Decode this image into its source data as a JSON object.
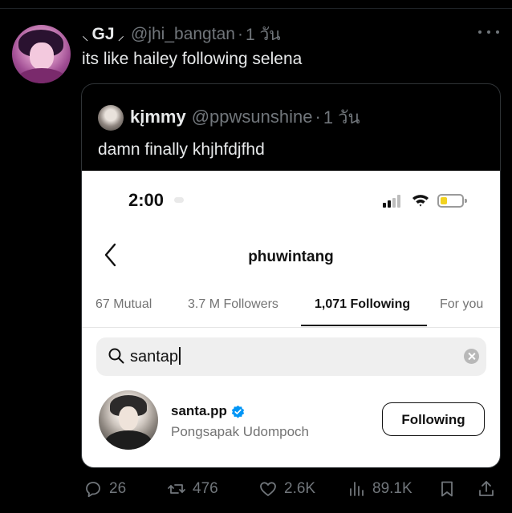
{
  "tweet": {
    "author_name": "GJ",
    "author_handle": "@jhi_bangtan",
    "separator": "·",
    "time": "1 วัน",
    "text": "its like hailey following selena"
  },
  "quote": {
    "author_name": "kįmmy",
    "author_handle": "@ppwsunshine",
    "separator": "·",
    "time": "1 วัน",
    "text": "damn finally khjhfdjfhd"
  },
  "screenshot": {
    "status_time": "2:00",
    "battery_level": 0.3,
    "battery_color": "#f2d21f",
    "profile_username": "phuwintang",
    "tabs": [
      {
        "label": "67 Mutual",
        "active": false
      },
      {
        "label": "3.7 M Followers",
        "active": false
      },
      {
        "label": "1,071 Following",
        "active": true
      },
      {
        "label": "For you",
        "active": false
      }
    ],
    "search_value": "santap",
    "result": {
      "username": "santa.pp",
      "verified": true,
      "full_name": "Pongsapak Udompoch",
      "button_label": "Following"
    }
  },
  "actions": {
    "replies": "26",
    "retweets": "476",
    "likes": "2.6K",
    "views": "89.1K"
  },
  "icons": [
    "more-icon",
    "back-chevron-icon",
    "signal-icon",
    "wifi-icon",
    "battery-icon",
    "search-icon",
    "clear-icon",
    "verified-badge-icon",
    "reply-icon",
    "retweet-icon",
    "like-icon",
    "views-icon",
    "bookmark-icon",
    "share-icon"
  ],
  "colors": {
    "background": "#000000",
    "text_primary": "#e7e9ea",
    "text_secondary": "#71767b",
    "verified_blue": "#0095f6"
  }
}
